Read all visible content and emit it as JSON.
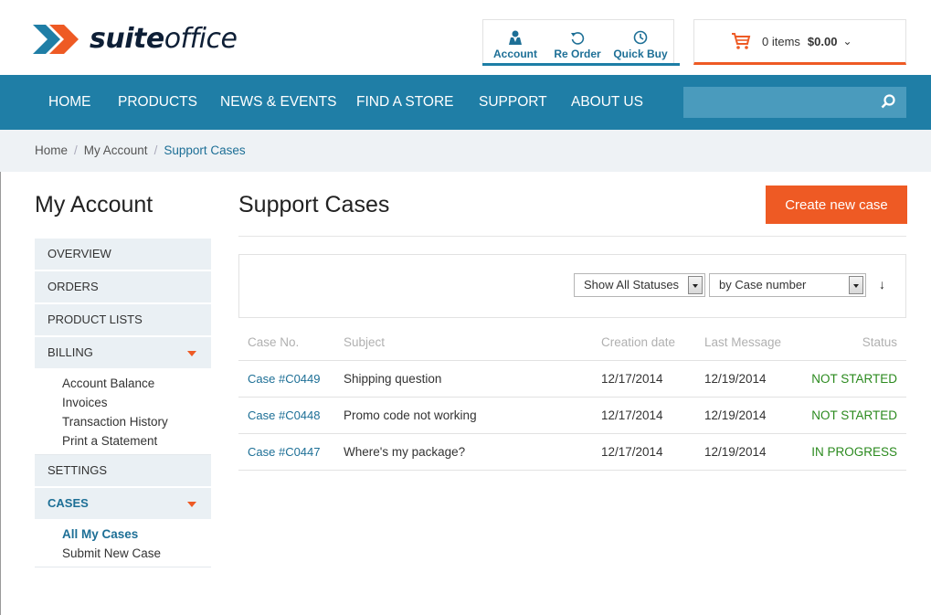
{
  "brand": {
    "name_bold": "suite",
    "name_light": "office",
    "logo_colors": [
      "#ee5a24",
      "#1f7ea6"
    ]
  },
  "quick_links": [
    {
      "label": "Account",
      "icon": "person-icon"
    },
    {
      "label": "Re Order",
      "icon": "reorder-icon"
    },
    {
      "label": "Quick Buy",
      "icon": "clock-icon"
    }
  ],
  "cart": {
    "items_text": "0 items",
    "amount": "$0.00",
    "icon": "cart-icon"
  },
  "nav": {
    "items": [
      "HOME",
      "PRODUCTS",
      "NEWS & EVENTS",
      "FIND A STORE",
      "SUPPORT",
      "ABOUT US"
    ],
    "search_placeholder": ""
  },
  "breadcrumb": [
    "Home",
    "My Account",
    "Support Cases"
  ],
  "sidebar": {
    "title": "My Account",
    "items": [
      {
        "label": "OVERVIEW"
      },
      {
        "label": "ORDERS"
      },
      {
        "label": "PRODUCT LISTS"
      },
      {
        "label": "BILLING",
        "expanded": true,
        "children": [
          "Account Balance",
          "Invoices",
          "Transaction History",
          "Print a Statement"
        ]
      },
      {
        "label": "SETTINGS"
      },
      {
        "label": "CASES",
        "expanded": true,
        "active": true,
        "children": [
          "All My Cases",
          "Submit New Case"
        ],
        "active_child": "All My Cases"
      }
    ]
  },
  "main": {
    "title": "Support Cases",
    "create_button": "Create new case",
    "filters": {
      "status": "Show All Statuses",
      "sort": "by Case number"
    },
    "table": {
      "headers": [
        "Case No.",
        "Subject",
        "Creation date",
        "Last Message",
        "Status"
      ],
      "rows": [
        {
          "case_no": "Case #C0449",
          "subject": "Shipping question",
          "created": "12/17/2014",
          "last_message": "12/19/2014",
          "status": "NOT STARTED"
        },
        {
          "case_no": "Case #C0448",
          "subject": "Promo code not working",
          "created": "12/17/2014",
          "last_message": "12/19/2014",
          "status": "NOT STARTED"
        },
        {
          "case_no": "Case #C0447",
          "subject": "Where's my package?",
          "created": "12/17/2014",
          "last_message": "12/19/2014",
          "status": "IN PROGRESS"
        }
      ]
    }
  },
  "colors": {
    "accent": "#ee5a24",
    "primary": "#1f7ea6",
    "status_ok": "#2b8a1e"
  }
}
